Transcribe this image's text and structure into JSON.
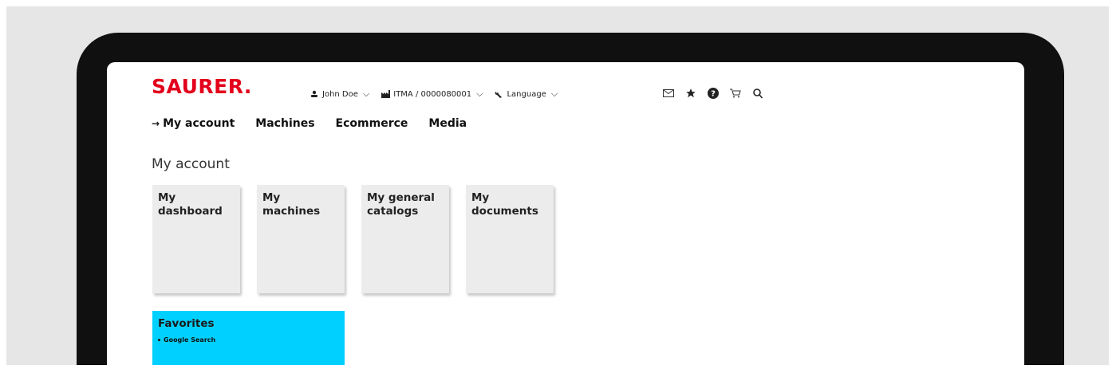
{
  "brand": {
    "logo_text": "SAURER.",
    "color": "#e3001b"
  },
  "topbar": {
    "user": {
      "label": "John Doe",
      "icon": "user-icon"
    },
    "company": {
      "label": "ITMA / 0000080001",
      "icon": "factory-icon"
    },
    "language": {
      "label": "Language",
      "icon": "wrench-icon"
    }
  },
  "tools": [
    "mail-icon",
    "star-icon",
    "help-icon",
    "cart-icon",
    "search-icon"
  ],
  "nav": {
    "items": [
      {
        "label": "My account",
        "active": true
      },
      {
        "label": "Machines"
      },
      {
        "label": "Ecommerce"
      },
      {
        "label": "Media"
      }
    ]
  },
  "page": {
    "title": "My account"
  },
  "tiles": [
    {
      "label": "My dashboard"
    },
    {
      "label": "My machines"
    },
    {
      "label": "My general catalogs"
    },
    {
      "label": "My documents"
    }
  ],
  "favorites": {
    "title": "Favorites",
    "items": [
      {
        "label": "Google Search"
      }
    ],
    "color": "#00d0ff"
  }
}
